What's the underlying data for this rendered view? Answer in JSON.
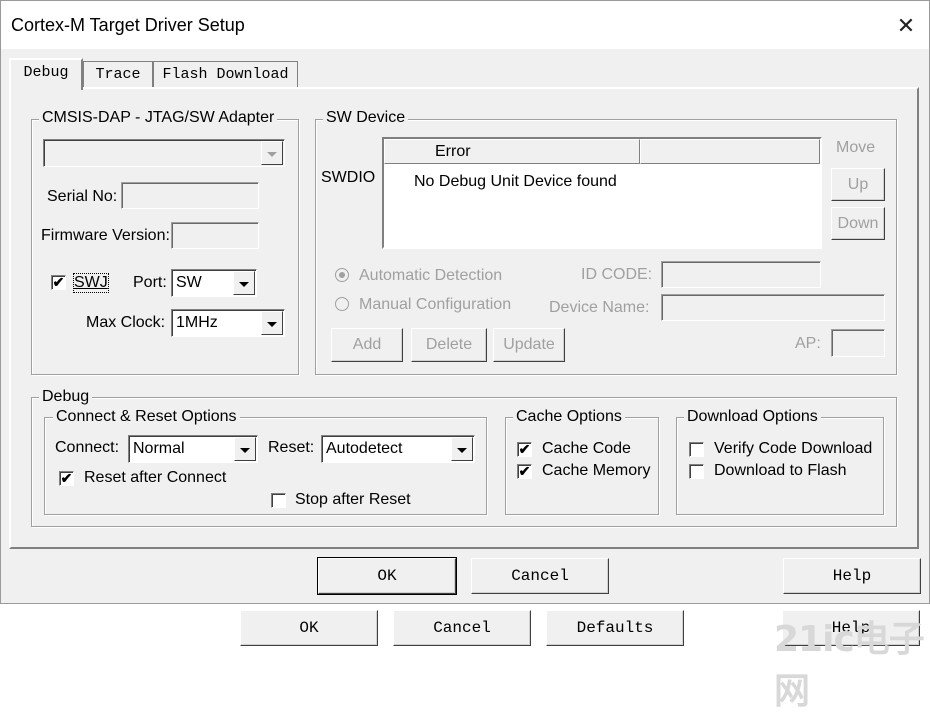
{
  "window": {
    "title": "Cortex-M Target Driver Setup",
    "close_glyph": "✕"
  },
  "tabs": [
    {
      "label": "Debug",
      "active": true
    },
    {
      "label": "Trace",
      "active": false
    },
    {
      "label": "Flash Download",
      "active": false
    }
  ],
  "adapter": {
    "group_label": "CMSIS-DAP - JTAG/SW Adapter",
    "selected": "",
    "serial_label": "Serial No:",
    "serial_value": "",
    "firmware_label": "Firmware Version:",
    "firmware_value": "",
    "swj_label": "SWJ",
    "swj_checked": "✔",
    "port_label": "Port:",
    "port_value": "SW",
    "clock_label": "Max Clock:",
    "clock_value": "1MHz"
  },
  "sw_device": {
    "group_label": "SW Device",
    "row_label": "SWDIO",
    "col_error": "Error",
    "col_blank": "",
    "message": "No Debug Unit Device found",
    "move_label": "Move",
    "up_label": "Up",
    "down_label": "Down",
    "auto_label": "Automatic Detection",
    "manual_label": "Manual Configuration",
    "idcode_label": "ID CODE:",
    "idcode_value": "",
    "devname_label": "Device Name:",
    "devname_value": "",
    "ap_label": "AP:",
    "ap_value": "",
    "add_label": "Add",
    "delete_label": "Delete",
    "update_label": "Update"
  },
  "debug": {
    "group_label": "Debug",
    "connect_group": "Connect & Reset Options",
    "connect_label": "Connect:",
    "connect_value": "Normal",
    "reset_label": "Reset:",
    "reset_value": "Autodetect",
    "reset_after_connect": "Reset after Connect",
    "reset_after_connect_checked": "✔",
    "stop_after_reset": "Stop after Reset",
    "cache_group": "Cache Options",
    "cache_code": "Cache Code",
    "cache_memory": "Cache Memory",
    "cache_checked": "✔",
    "download_group": "Download Options",
    "verify_download": "Verify Code Download",
    "download_flash": "Download to Flash"
  },
  "dialog_buttons": {
    "ok": "OK",
    "cancel": "Cancel",
    "help": "Help"
  },
  "parent_buttons": {
    "ok": "OK",
    "cancel": "Cancel",
    "defaults": "Defaults",
    "help": "Help"
  },
  "watermark": "21ic电子网"
}
